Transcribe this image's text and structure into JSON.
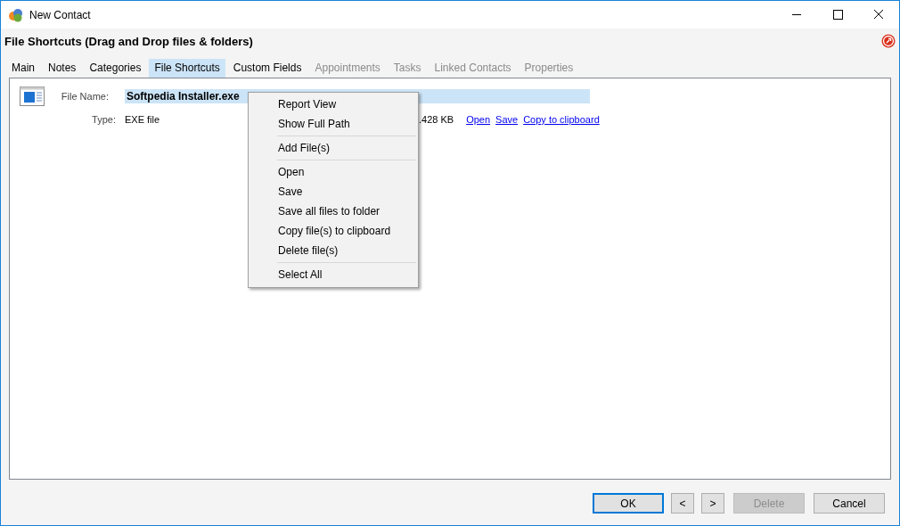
{
  "window": {
    "title": "New Contact"
  },
  "header": {
    "title": "File Shortcuts (Drag and Drop files & folders)"
  },
  "tabs": [
    {
      "label": "Main",
      "selected": false,
      "disabled": false
    },
    {
      "label": "Notes",
      "selected": false,
      "disabled": false
    },
    {
      "label": "Categories",
      "selected": false,
      "disabled": false
    },
    {
      "label": "File Shortcuts",
      "selected": true,
      "disabled": false
    },
    {
      "label": "Custom Fields",
      "selected": false,
      "disabled": false
    },
    {
      "label": "Appointments",
      "selected": false,
      "disabled": true
    },
    {
      "label": "Tasks",
      "selected": false,
      "disabled": true
    },
    {
      "label": "Linked Contacts",
      "selected": false,
      "disabled": true
    },
    {
      "label": "Properties",
      "selected": false,
      "disabled": true
    }
  ],
  "file": {
    "name_label": "File Name:",
    "name": "Softpedia Installer.exe",
    "type_label": "Type:",
    "type": "EXE file",
    "size": ".428 KB",
    "links": [
      "Open",
      "Save",
      "Copy to clipboard"
    ]
  },
  "context_menu": {
    "groups": [
      [
        "Report View",
        "Show Full Path"
      ],
      [
        "Add File(s)"
      ],
      [
        "Open",
        "Save",
        "Save all files to folder",
        "Copy file(s) to clipboard",
        "Delete file(s)"
      ],
      [
        "Select All"
      ]
    ]
  },
  "buttons": [
    {
      "label": "OK",
      "default": true,
      "disabled": false
    },
    {
      "label": "<",
      "default": false,
      "disabled": false
    },
    {
      "label": ">",
      "default": false,
      "disabled": false
    },
    {
      "label": "Delete",
      "default": false,
      "disabled": true
    },
    {
      "label": "Cancel",
      "default": false,
      "disabled": false
    }
  ]
}
